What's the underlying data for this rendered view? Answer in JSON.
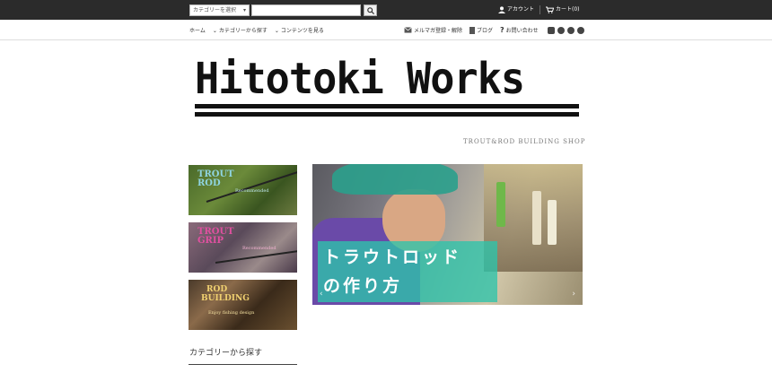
{
  "topbar": {
    "category_select": "カテゴリーを選択",
    "search_value": "",
    "account_label": "アカウント",
    "cart_label": "カート(0)"
  },
  "nav": {
    "home": "ホーム",
    "categories": "カテゴリーから探す",
    "contents": "コンテンツを見る",
    "newsletter": "メルマガ登録・解除",
    "blog": "ブログ",
    "contact": "お問い合わせ",
    "social_icons": [
      "instagram-icon",
      "facebook-icon",
      "pinterest-icon",
      "pinterest-icon"
    ]
  },
  "brand": {
    "logo_text": "Hitotoki Works",
    "tagline": "TROUT&ROD BUILDING SHOP"
  },
  "side_banners": [
    {
      "title_lines": [
        "TROUT",
        "ROD"
      ],
      "subtitle": "Recommended"
    },
    {
      "title_lines": [
        "TROUT",
        "GRIP"
      ],
      "subtitle": "Recommended"
    },
    {
      "title_lines": [
        "ROD",
        "BUILDING"
      ],
      "subtitle": "Enjoy fishing design"
    }
  ],
  "hero": {
    "caption_line1": "トラウトロッド",
    "caption_line2": "の作り方"
  },
  "sidebar": {
    "category_heading": "カテゴリーから探す"
  },
  "colors": {
    "topbar_bg": "#2b2b2b",
    "hero_band": "#2dc4aa"
  }
}
